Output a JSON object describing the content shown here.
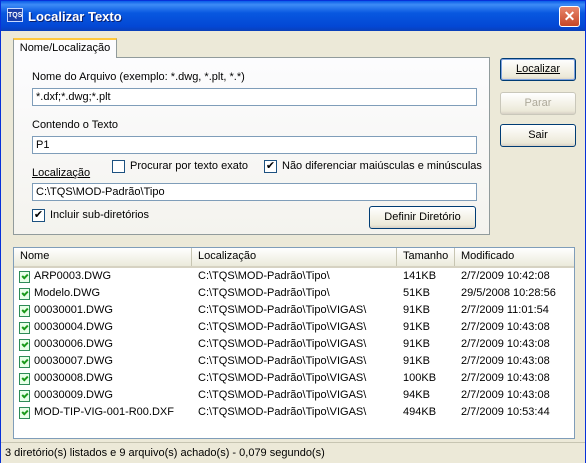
{
  "window": {
    "title": "Localizar Texto",
    "icon_text": "TQS"
  },
  "tab": {
    "label": "Nome/Localização"
  },
  "form": {
    "filename_label": "Nome do Arquivo (exemplo: *.dwg, *.plt, *.*)",
    "filename_value": "*.dxf;*.dwg;*.plt",
    "contains_label": "Contendo o Texto",
    "contains_value": "P1",
    "location_label": "Localização",
    "exact_text_label": "Procurar por texto exato",
    "exact_text_checked": false,
    "ignore_case_label": "Não diferenciar maiúsculas e minúsculas",
    "ignore_case_checked": true,
    "location_value": "C:\\TQS\\MOD-Padrão\\Tipo",
    "subdirs_label": "Incluir sub-diretórios",
    "subdirs_checked": true,
    "define_dir_button": "Definir Diretório"
  },
  "buttons": {
    "search": "Localizar",
    "stop": "Parar",
    "exit": "Sair"
  },
  "list": {
    "columns": [
      "Nome",
      "Localização",
      "Tamanho",
      "Modificado"
    ],
    "rows": [
      {
        "name": "ARP0003.DWG",
        "location": "C:\\TQS\\MOD-Padrão\\Tipo\\",
        "size": "141KB",
        "modified": "2/7/2009 10:42:08"
      },
      {
        "name": "Modelo.DWG",
        "location": "C:\\TQS\\MOD-Padrão\\Tipo\\",
        "size": "51KB",
        "modified": "29/5/2008 10:28:56"
      },
      {
        "name": "00030001.DWG",
        "location": "C:\\TQS\\MOD-Padrão\\Tipo\\VIGAS\\",
        "size": "91KB",
        "modified": "2/7/2009 11:01:54"
      },
      {
        "name": "00030004.DWG",
        "location": "C:\\TQS\\MOD-Padrão\\Tipo\\VIGAS\\",
        "size": "91KB",
        "modified": "2/7/2009 10:43:08"
      },
      {
        "name": "00030006.DWG",
        "location": "C:\\TQS\\MOD-Padrão\\Tipo\\VIGAS\\",
        "size": "91KB",
        "modified": "2/7/2009 10:43:08"
      },
      {
        "name": "00030007.DWG",
        "location": "C:\\TQS\\MOD-Padrão\\Tipo\\VIGAS\\",
        "size": "91KB",
        "modified": "2/7/2009 10:43:08"
      },
      {
        "name": "00030008.DWG",
        "location": "C:\\TQS\\MOD-Padrão\\Tipo\\VIGAS\\",
        "size": "100KB",
        "modified": "2/7/2009 10:43:08"
      },
      {
        "name": "00030009.DWG",
        "location": "C:\\TQS\\MOD-Padrão\\Tipo\\VIGAS\\",
        "size": "94KB",
        "modified": "2/7/2009 10:43:08"
      },
      {
        "name": "MOD-TIP-VIG-001-R00.DXF",
        "location": "C:\\TQS\\MOD-Padrão\\Tipo\\VIGAS\\",
        "size": "494KB",
        "modified": "2/7/2009 10:53:44"
      }
    ]
  },
  "status": {
    "text": "3 diretório(s) listados e 9 arquivo(s) achado(s) - 0,079 segundo(s)"
  }
}
